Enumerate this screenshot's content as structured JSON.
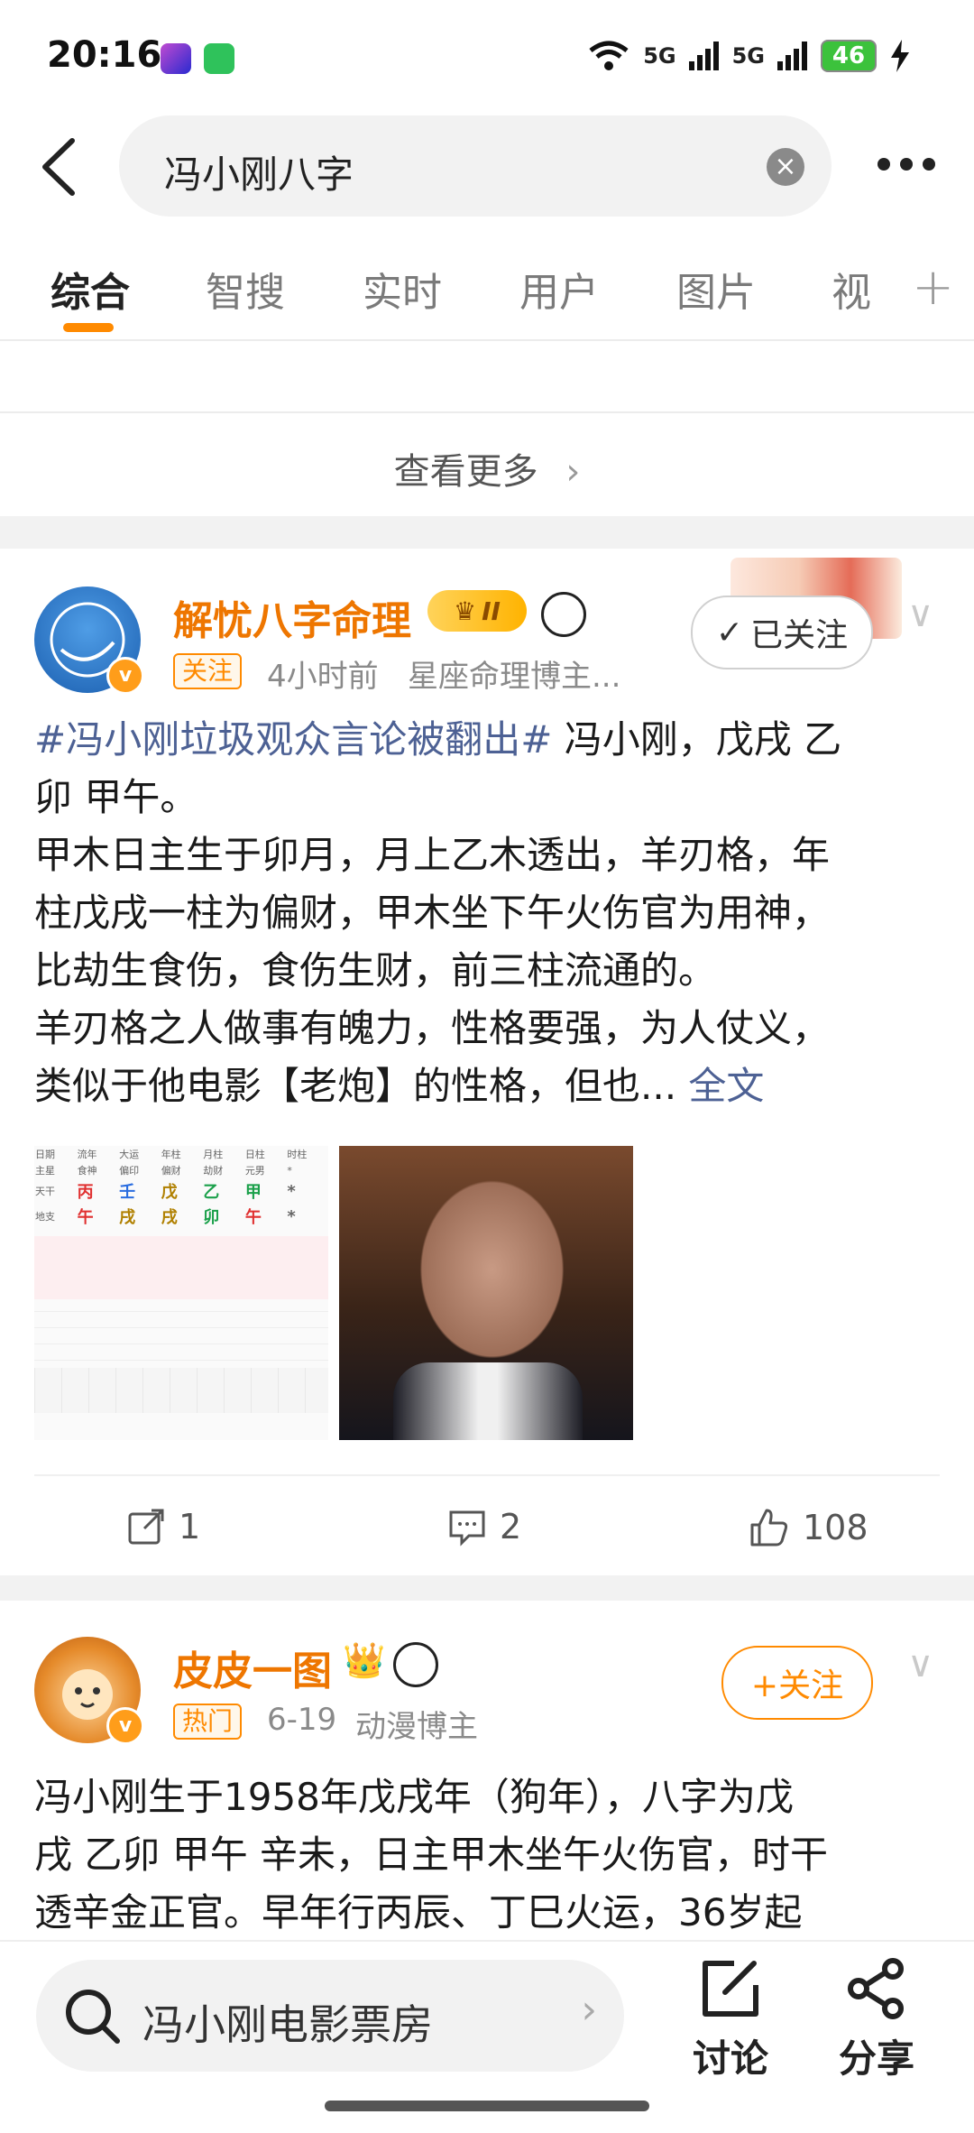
{
  "status_bar": {
    "time": "20:16",
    "battery": "46",
    "network1": "5G",
    "network2": "5G"
  },
  "search": {
    "query": "冯小刚八字"
  },
  "tabs": [
    "综合",
    "智搜",
    "实时",
    "用户",
    "图片",
    "视"
  ],
  "see_more": "查看更多",
  "post1": {
    "author": "解忧八字命理",
    "level_badge": "II",
    "tag": "关注",
    "time": "4小时前",
    "category": "星座命理博主...",
    "follow_label": "已关注",
    "hashtag": "#冯小刚垃圾观众言论被翻出#",
    "lines": [
      "冯小刚，戊戌 乙",
      "卯 甲午。",
      "甲木日主生于卯月，月上乙木透出，羊刃格，年",
      "柱戊戌一柱为偏财，甲木坐下午火伤官为用神，",
      "比劫生食伤，食伤生财，前三柱流通的。",
      "羊刃格之人做事有魄力，性格要强，为人仗义，",
      "类似于他电影【老炮】的性格，但也..."
    ],
    "full_text": "全文",
    "chart_table": {
      "head": [
        "日期",
        "流年",
        "大运",
        "年柱",
        "月柱",
        "日柱",
        "时柱"
      ],
      "row1": [
        "主星",
        "食神",
        "偏印",
        "偏财",
        "劫财",
        "元男",
        "*"
      ],
      "row2": [
        "天干",
        "丙",
        "壬",
        "戊",
        "乙",
        "甲",
        "*"
      ],
      "row3": [
        "地支",
        "午",
        "戌",
        "戌",
        "卯",
        "午",
        "*"
      ]
    },
    "repost_count": "1",
    "comment_count": "2",
    "like_count": "108"
  },
  "post2": {
    "author": "皮皮一图",
    "tag": "热门",
    "time": "6-19",
    "category": "动漫博主",
    "follow_label": "+关注",
    "lines": [
      "冯小刚生于1958年戊戌年（狗年），八字为戊",
      "戌 乙卯 甲午 辛未，日主甲木坐午火伤官，时干",
      "透辛金正官。早年行丙辰、丁巳火运，36岁起"
    ]
  },
  "bottom_bar": {
    "search_placeholder": "冯小刚电影票房",
    "discuss_label": "讨论",
    "share_label": "分享"
  },
  "colors": {
    "accent": "#ff8a00",
    "link": "#4d6194",
    "author": "#ee7600"
  }
}
